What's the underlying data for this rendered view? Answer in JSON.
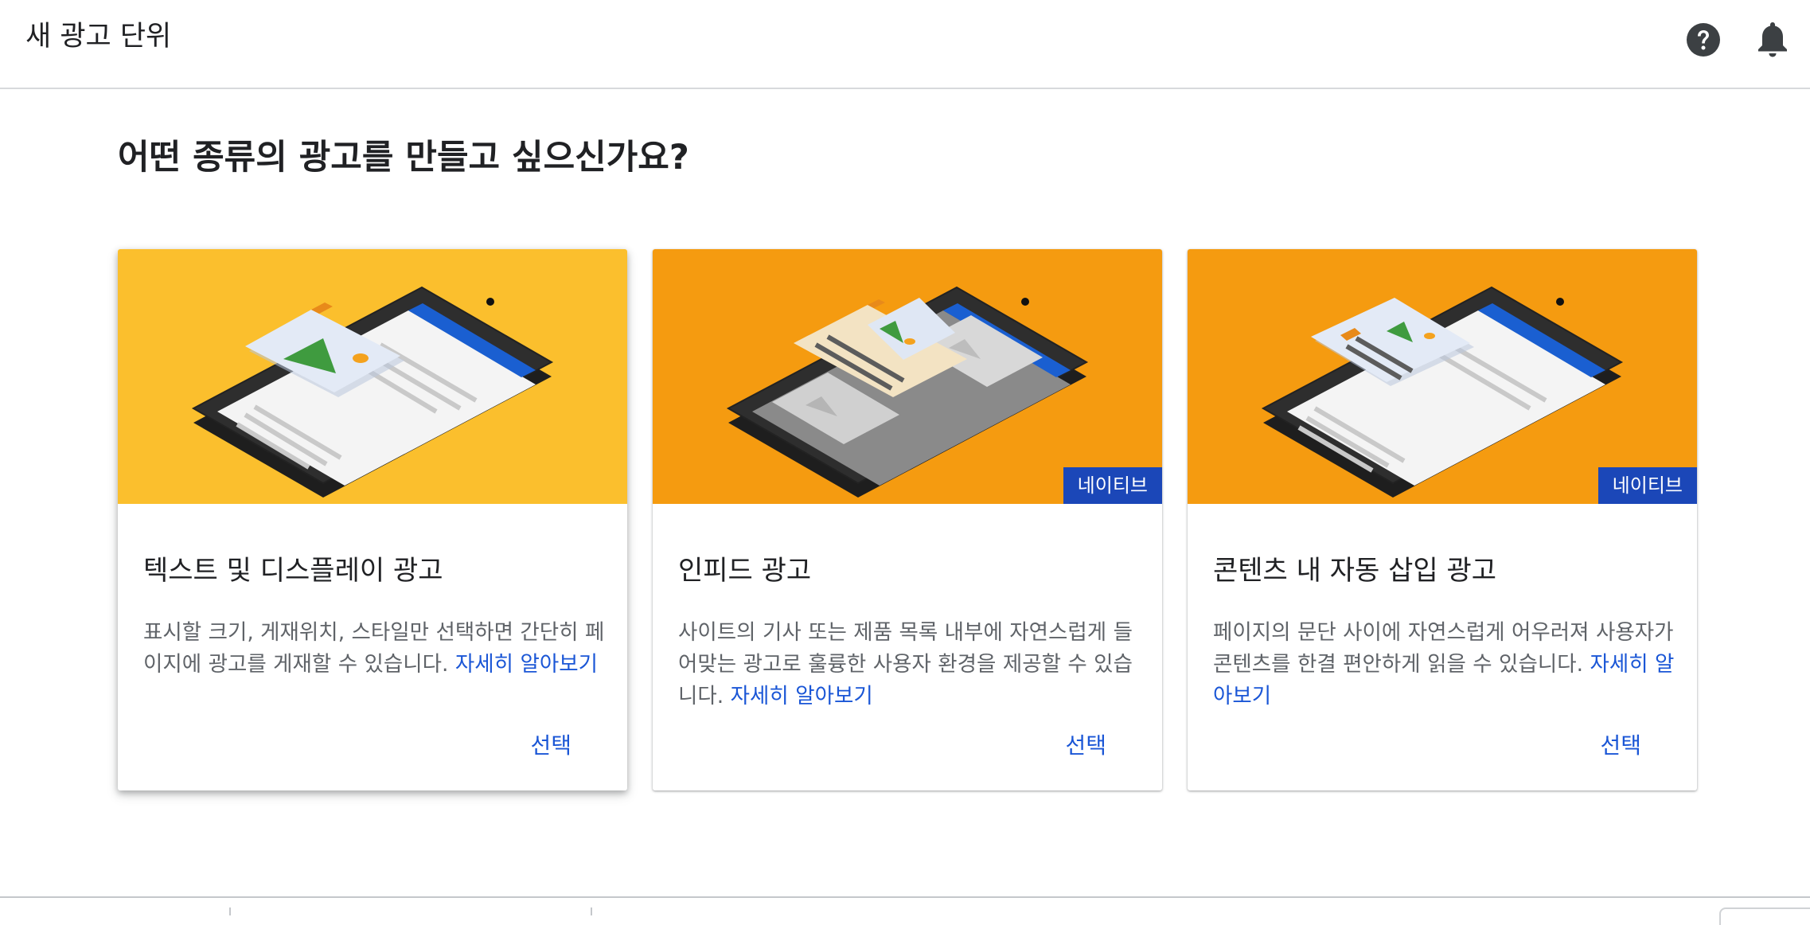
{
  "header": {
    "title": "새 광고 단위",
    "help_icon": "help-circle-icon",
    "notifications_icon": "bell-icon"
  },
  "main": {
    "heading": "어떤 종류의 광고를 만들고 싶으신가요?",
    "cards": [
      {
        "title": "텍스트 및 디스플레이 광고",
        "description": "표시할 크기, 게재위치, 스타일만 선택하면 간단히 페이지에 광고를 게재할 수 있습니다.",
        "learn_more": "자세히 알아보기",
        "select_label": "선택",
        "hero_color": "#fbbf2d"
      },
      {
        "title": "인피드 광고",
        "description": "사이트의 기사 또는 제품 목록 내부에 자연스럽게 들어맞는 광고로 훌륭한 사용자 환경을 제공할 수 있습니다.",
        "learn_more": "자세히 알아보기",
        "select_label": "선택",
        "badge": "네이티브",
        "hero_color": "#f59b10"
      },
      {
        "title": "콘텐츠 내 자동 삽입 광고",
        "description": "페이지의 문단 사이에 자연스럽게 어우러져 사용자가 콘텐츠를 한결 편안하게 읽을 수 있습니다.",
        "learn_more": "자세히 알아보기",
        "select_label": "선택",
        "badge": "네이티브",
        "hero_color": "#f59b10"
      }
    ]
  },
  "colors": {
    "link": "#1a56d6",
    "badge_bg": "#1b47b8",
    "phone_body": "#2b2b2b",
    "screen_header": "#1a5fd1",
    "image_accent": "#3f9b3f"
  }
}
